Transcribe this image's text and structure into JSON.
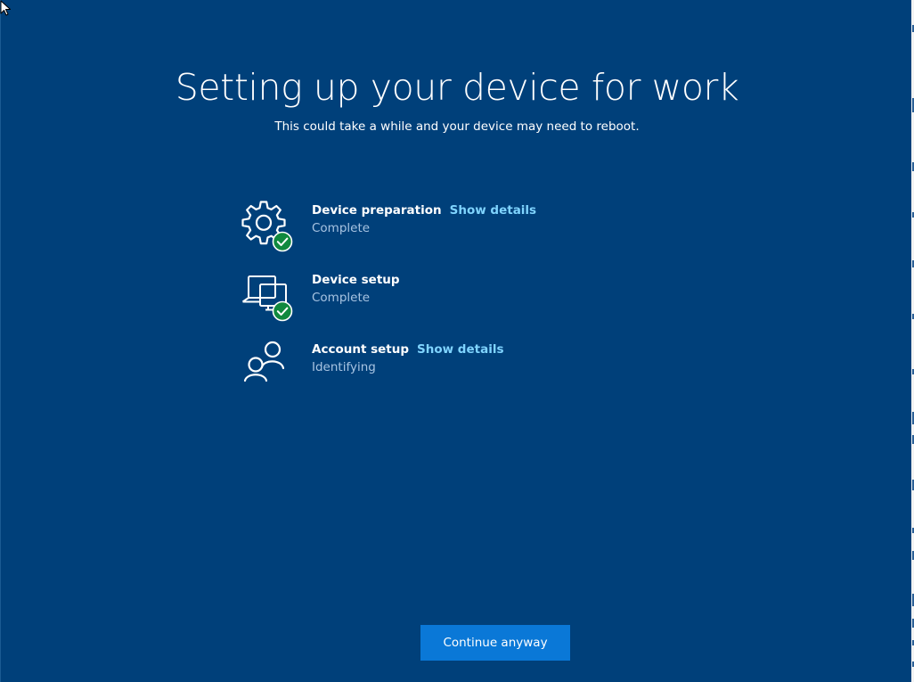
{
  "page": {
    "title": "Setting up your device for work",
    "subtitle": "This could take a while and your device may need to reboot."
  },
  "steps": [
    {
      "name": "Device preparation",
      "status": "Complete",
      "link": "Show details",
      "icon": "gear-icon",
      "completed": true
    },
    {
      "name": "Device setup",
      "status": "Complete",
      "link": "",
      "icon": "devices-icon",
      "completed": true
    },
    {
      "name": "Account setup",
      "status": "Identifying",
      "link": "Show details",
      "icon": "people-icon",
      "completed": false
    }
  ],
  "footer": {
    "continue_label": "Continue anyway"
  },
  "colors": {
    "background": "#00407A",
    "link": "#7FD4FF",
    "status_text": "#A8C4E2",
    "button": "#0A78D7",
    "check_badge": "#10893E"
  }
}
